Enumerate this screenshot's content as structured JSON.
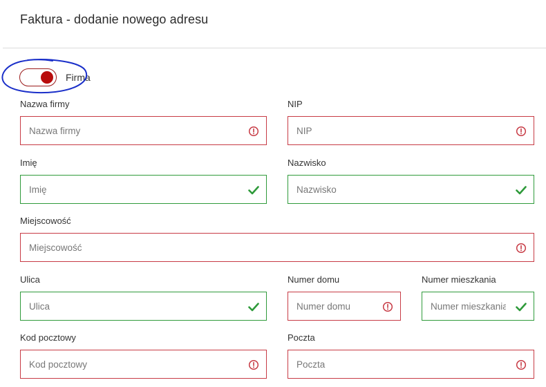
{
  "header": {
    "title": "Faktura - dodanie nowego adresu"
  },
  "toggle": {
    "label": "Firma",
    "checked": true,
    "accent_color": "#b80c0c"
  },
  "annotation": {
    "color": "#1a2fc9"
  },
  "colors": {
    "error": "#c73a44",
    "valid": "#2e9a3a"
  },
  "fields": {
    "company_name": {
      "label": "Nazwa firmy",
      "placeholder": "Nazwa firmy",
      "value": "",
      "status": "error",
      "status_icon": "error-circle-icon"
    },
    "nip": {
      "label": "NIP",
      "placeholder": "NIP",
      "value": "",
      "status": "error",
      "status_icon": "error-circle-icon"
    },
    "first_name": {
      "label": "Imię",
      "placeholder": "Imię",
      "value": "",
      "status": "valid",
      "status_icon": "checkmark-icon"
    },
    "last_name": {
      "label": "Nazwisko",
      "placeholder": "Nazwisko",
      "value": "",
      "status": "valid",
      "status_icon": "checkmark-icon"
    },
    "city": {
      "label": "Miejscowość",
      "placeholder": "Miejscowość",
      "value": "",
      "status": "error",
      "status_icon": "error-circle-icon"
    },
    "street": {
      "label": "Ulica",
      "placeholder": "Ulica",
      "value": "",
      "status": "valid",
      "status_icon": "checkmark-icon"
    },
    "house_number": {
      "label": "Numer domu",
      "placeholder": "Numer domu",
      "value": "",
      "status": "error",
      "status_icon": "error-circle-icon"
    },
    "apartment_number": {
      "label": "Numer mieszkania",
      "placeholder": "Numer mieszkania",
      "value": "",
      "status": "valid",
      "status_icon": "checkmark-icon"
    },
    "postal_code": {
      "label": "Kod pocztowy",
      "placeholder": "Kod pocztowy",
      "value": "",
      "status": "error",
      "status_icon": "error-circle-icon"
    },
    "post_office": {
      "label": "Poczta",
      "placeholder": "Poczta",
      "value": "",
      "status": "error",
      "status_icon": "error-circle-icon"
    }
  }
}
